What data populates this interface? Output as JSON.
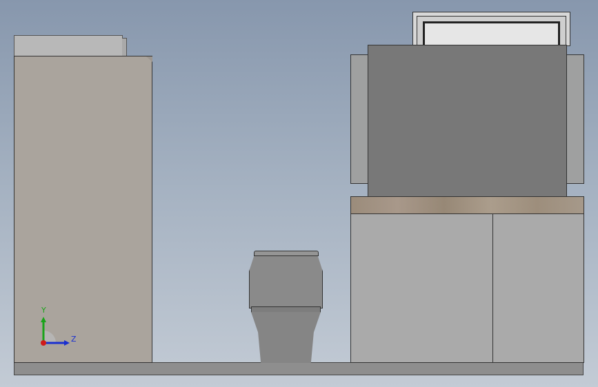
{
  "scene": {
    "description_objects": [
      "tall-cabinet",
      "toilet",
      "vanity",
      "mirror",
      "floor"
    ]
  },
  "triad": {
    "y_label": "Y",
    "z_label": "Z",
    "y_color": "#1aa31a",
    "z_color": "#1a2fd0",
    "x_color": "#d01a1a"
  },
  "colors": {
    "background_top": "#8797ad",
    "background_bottom": "#c3cbd5",
    "tall_cabinet": "#aaa49d",
    "vanity_body": "#aaaaaa",
    "cabinet_back": "#787878",
    "countertop": "#9f9080",
    "floor": "#8e8e8e"
  }
}
